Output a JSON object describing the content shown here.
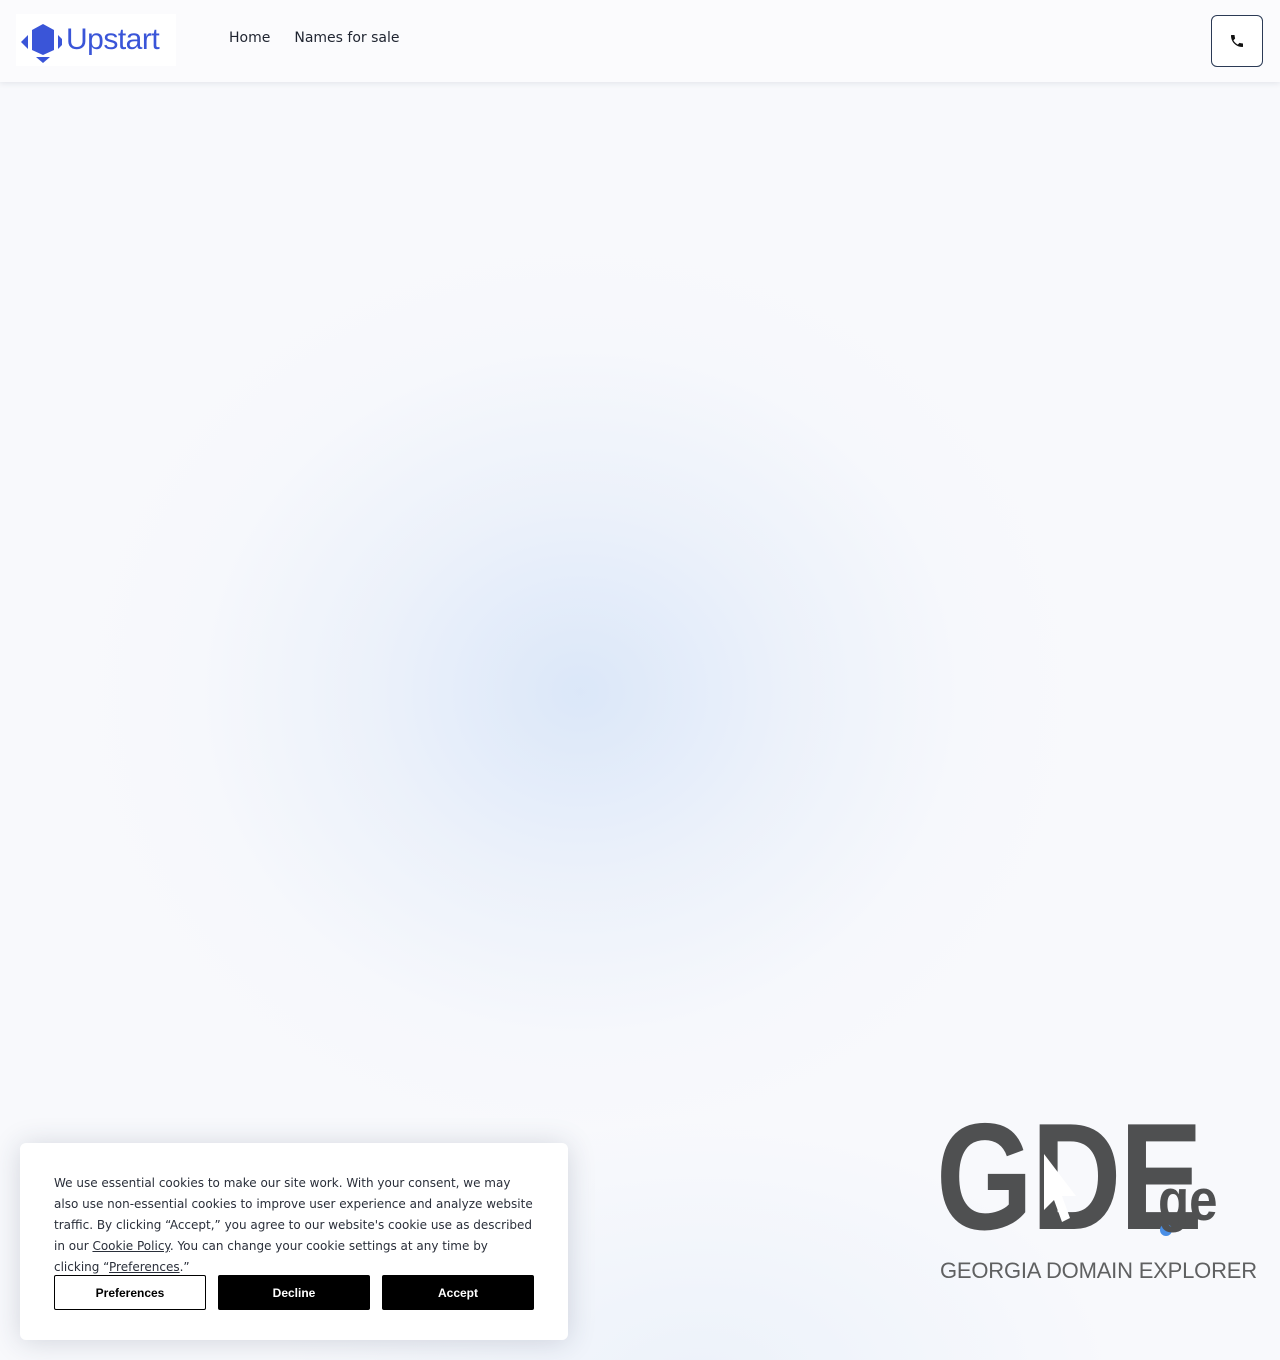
{
  "header": {
    "logo_text": "Upstart",
    "nav": [
      {
        "label": "Home"
      },
      {
        "label": "Names for sale"
      }
    ],
    "phone_icon": "phone-icon"
  },
  "brand_colors": {
    "accent": "#3a55d8",
    "gde_gray": "#4f5051",
    "gde_dot": "#4a8fe6"
  },
  "gde_logo": {
    "letters": "GDE",
    "suffix": "ge",
    "tagline": "GEORGIA DOMAIN EXPLORER"
  },
  "cookie_banner": {
    "text_1": "We use essential cookies to make our site work. With your consent, we may also use non-essential cookies to improve user experience and analyze website traffic. By clicking “Accept,” you agree to our website's cookie use as described in our ",
    "link_cookie_policy": "Cookie Policy",
    "text_2": ". You can change your cookie settings at any time by clicking “",
    "link_preferences": "Preferences",
    "text_3": ".”",
    "buttons": {
      "preferences": "Preferences",
      "decline": "Decline",
      "accept": "Accept"
    }
  }
}
